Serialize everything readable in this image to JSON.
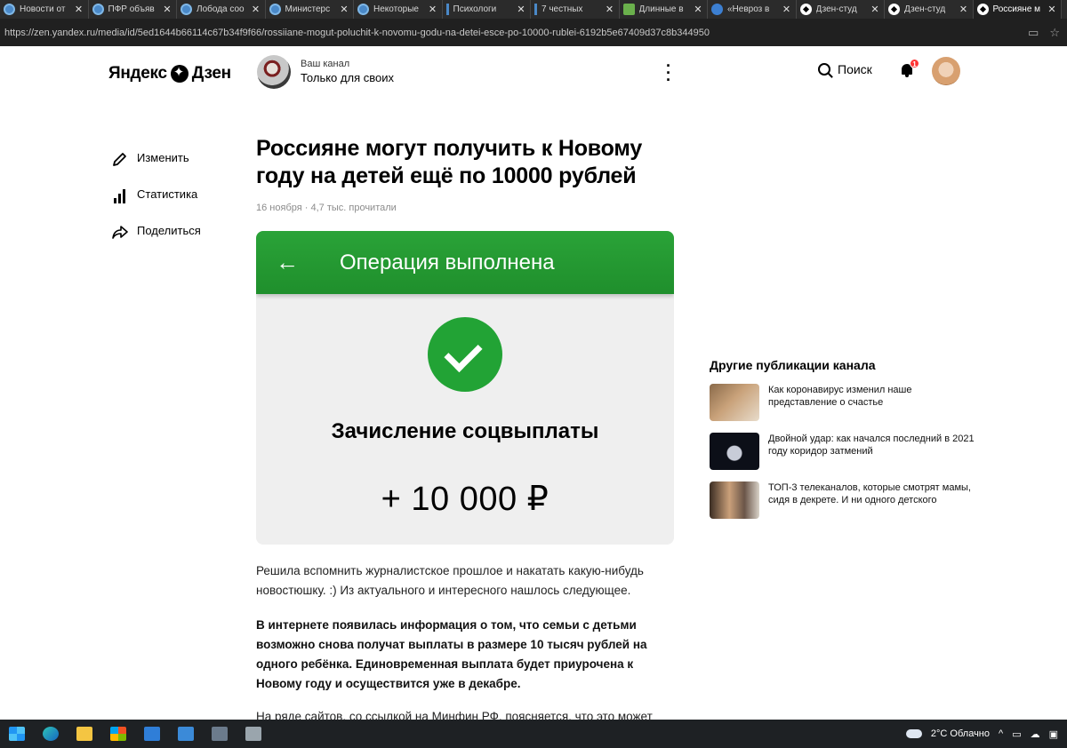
{
  "browser": {
    "tabs": [
      {
        "title": "Новости от",
        "fav": "edge"
      },
      {
        "title": "ПФР объяв",
        "fav": "edge"
      },
      {
        "title": "Лобода соо",
        "fav": "edge"
      },
      {
        "title": "Министерс",
        "fav": "edge"
      },
      {
        "title": "Некоторые",
        "fav": "edge"
      },
      {
        "title": "Психологи",
        "fav": "line"
      },
      {
        "title": "7 честных",
        "fav": "line"
      },
      {
        "title": "Длинные в",
        "fav": "green"
      },
      {
        "title": "«Невроз в",
        "fav": "blue"
      },
      {
        "title": "Дзен-студ",
        "fav": "zen"
      },
      {
        "title": "Дзен-студ",
        "fav": "zen"
      },
      {
        "title": "Россияне м",
        "fav": "zen",
        "active": true
      }
    ],
    "close_glyph": "✕",
    "url": "https://zen.yandex.ru/media/id/5ed1644b66114c67b34f9f66/rossiiane-mogut-poluchit-k-novomu-godu-na-detei-esce-po-10000-rublei-6192b5e67409d37c8b344950"
  },
  "header": {
    "logo_left": "Яндекс",
    "logo_right": "Дзен",
    "channel_sub": "Ваш канал",
    "channel_name": "Только для своих",
    "search_label": "Поиск",
    "notifications_count": "1"
  },
  "side_actions": [
    {
      "label": "Изменить",
      "icon": "pencil-icon"
    },
    {
      "label": "Статистика",
      "icon": "stats-icon"
    },
    {
      "label": "Поделиться",
      "icon": "share-icon"
    }
  ],
  "article": {
    "title": "Россияне могут получить к Новому году на детей ещё по 10000 рублей",
    "meta": "16 ноября · 4,7 тыс. прочитали",
    "card": {
      "header": "Операция выполнена",
      "operation": "Зачисление соцвыплаты",
      "amount": "+ 10 000 ₽"
    },
    "para1": "Решила вспомнить журналистское прошлое и накатать какую-нибудь новостюшку. :) Из актуального и интересного нашлось следующее.",
    "para2": "В интернете появилась информация о том, что семьи с детьми возможно снова получат выплаты в размере 10 тысяч рублей на одного ребёнка. Единовременная выплата будет приурочена к Новому году и осуществится уже в декабре.",
    "para3": "На ряде сайтов, со ссылкой на Минфин РФ, поясняется, что это может стать"
  },
  "other_publications": {
    "title": "Другие публикации канала",
    "items": [
      {
        "text": "Как коронавирус изменил наше представление о счастье"
      },
      {
        "text": "Двойной удар: как начался последний в 2021 году коридор затмений"
      },
      {
        "text": "ТОП-3 телеканалов, которые смотрят мамы, сидя в декрете. И ни одного детского"
      }
    ]
  },
  "taskbar": {
    "weather": "2°C  Облачно"
  },
  "colors": {
    "green_header": "#2aa338",
    "check_green": "#22a335",
    "badge_red": "#ff3333"
  }
}
